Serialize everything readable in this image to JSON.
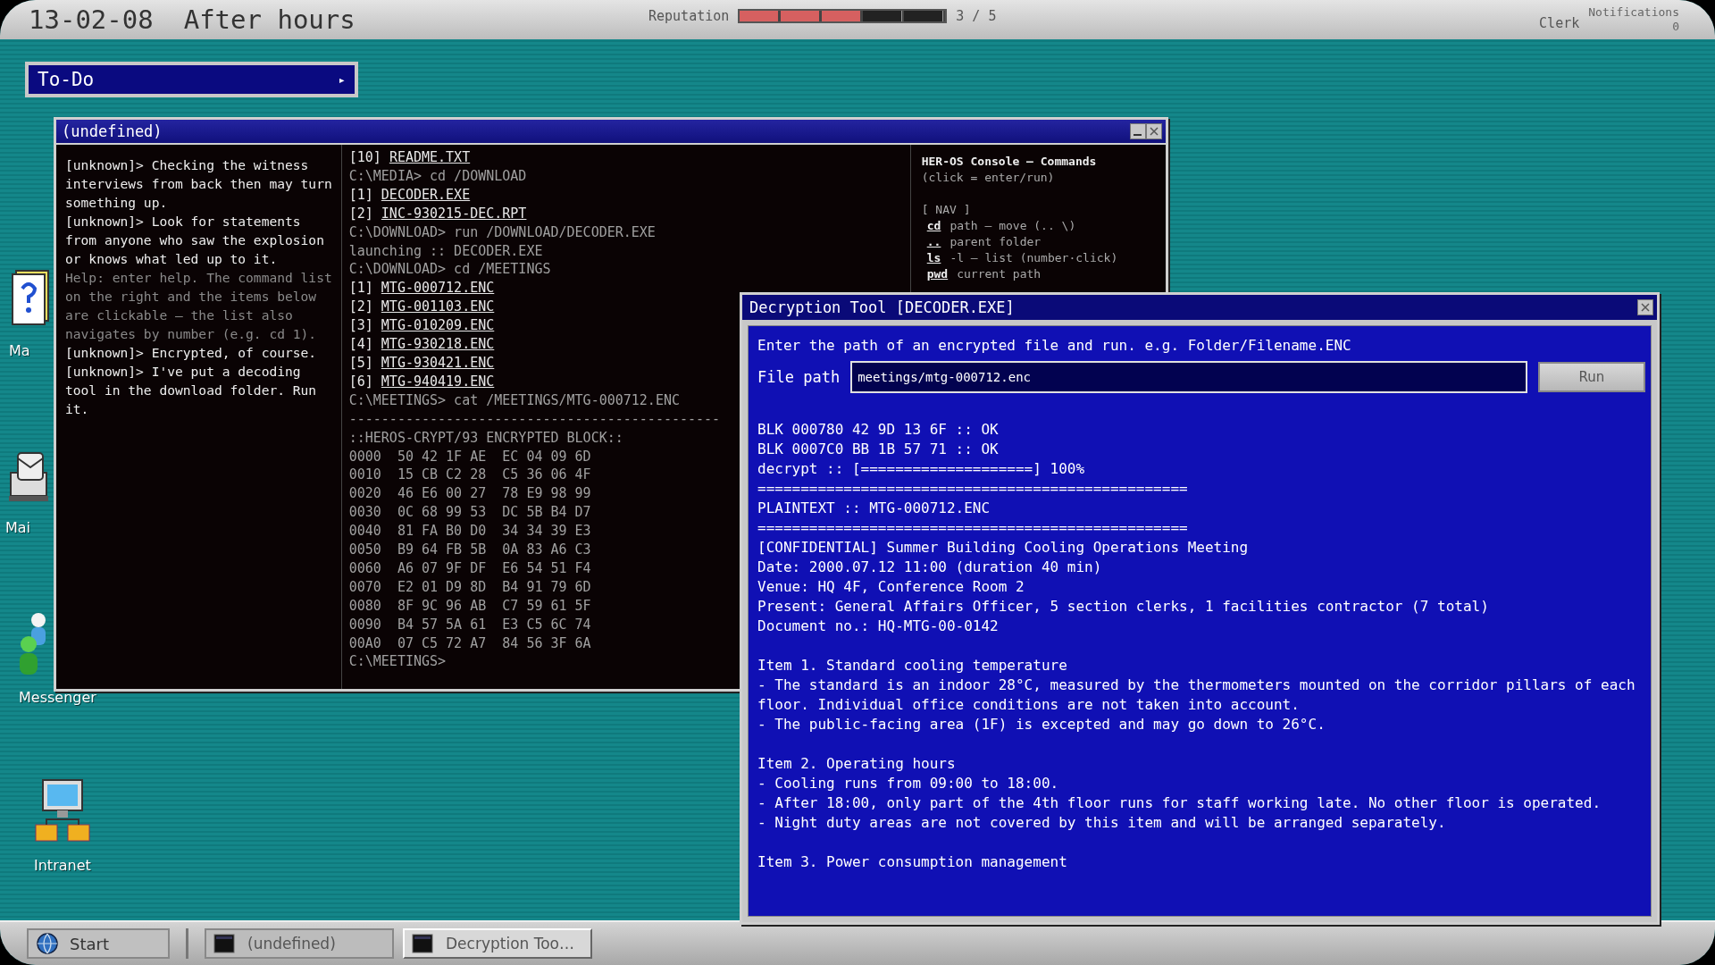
{
  "top_bar": {
    "date": "13-02-08",
    "phase": "After hours",
    "reputation": {
      "label": "Reputation",
      "level": 0.6,
      "reading": "3 / 5"
    },
    "role": "Clerk",
    "notifications": {
      "label": "Notifications",
      "count": "0"
    }
  },
  "todo": {
    "title": "To-Do",
    "arrow": "▸"
  },
  "desktop_icons": [
    {
      "kind": "help-book",
      "label": "Ma"
    },
    {
      "kind": "mail",
      "label": "Mai"
    },
    {
      "kind": "messenger",
      "label": "Messenger"
    },
    {
      "kind": "intranet",
      "label": "Intranet"
    }
  ],
  "console_window": {
    "title": "(undefined)",
    "messages": [
      {
        "kind": "chat",
        "text": "[unknown]> Checking the witness interviews from back then may turn something up."
      },
      {
        "kind": "chat",
        "text": "[unknown]> Look for statements from anyone who saw the explosion or knows what led up to it."
      },
      {
        "kind": "help",
        "text": "Help: enter help. The command list on the right and the items below are clickable — the list also navigates by number (e.g. cd 1)."
      },
      {
        "kind": "chat",
        "text": "[unknown]> Encrypted, of course."
      },
      {
        "kind": "chat",
        "text": "[unknown]> I've put a decoding tool in the download folder. Run it."
      }
    ],
    "listing": [
      {
        "kind": "item",
        "index": "[10]",
        "name": "README.TXT"
      },
      {
        "kind": "output",
        "text": "C:\\MEDIA> cd /DOWNLOAD"
      },
      {
        "kind": "item",
        "index": "[1]",
        "name": "DECODER.EXE"
      },
      {
        "kind": "item",
        "index": "[2]",
        "name": "INC-930215-DEC.RPT"
      },
      {
        "kind": "output",
        "text": "C:\\DOWNLOAD> run /DOWNLOAD/DECODER.EXE"
      },
      {
        "kind": "output",
        "text": "launching :: DECODER.EXE"
      },
      {
        "kind": "output",
        "text": "C:\\DOWNLOAD> cd /MEETINGS"
      },
      {
        "kind": "item",
        "index": "[1]",
        "name": "MTG-000712.ENC"
      },
      {
        "kind": "item",
        "index": "[2]",
        "name": "MTG-001103.ENC"
      },
      {
        "kind": "item",
        "index": "[3]",
        "name": "MTG-010209.ENC"
      },
      {
        "kind": "item",
        "index": "[4]",
        "name": "MTG-930218.ENC"
      },
      {
        "kind": "item",
        "index": "[5]",
        "name": "MTG-930421.ENC"
      },
      {
        "kind": "item",
        "index": "[6]",
        "name": "MTG-940419.ENC"
      },
      {
        "kind": "output",
        "text": "C:\\MEETINGS> cat /MEETINGS/MTG-000712.ENC"
      },
      {
        "kind": "output",
        "text": "----------------------------------------------"
      },
      {
        "kind": "output",
        "text": "::HEROS-CRYPT/93 ENCRYPTED BLOCK::"
      },
      {
        "kind": "output",
        "text": "0000  50 42 1F AE  EC 04 09 6D"
      },
      {
        "kind": "output",
        "text": "0010  15 CB C2 28  C5 36 06 4F"
      },
      {
        "kind": "output",
        "text": "0020  46 E6 00 27  78 E9 98 99"
      },
      {
        "kind": "output",
        "text": "0030  0C 68 99 53  DC 5B B4 D7"
      },
      {
        "kind": "output",
        "text": "0040  81 FA B0 D0  34 34 39 E3"
      },
      {
        "kind": "output",
        "text": "0050  B9 64 FB 5B  0A 83 A6 C3"
      },
      {
        "kind": "output",
        "text": "0060  A6 07 9F DF  E6 54 51 F4"
      },
      {
        "kind": "output",
        "text": "0070  E2 01 D9 8D  B4 91 79 6D"
      },
      {
        "kind": "output",
        "text": "0080  8F 9C 96 AB  C7 59 61 5F"
      },
      {
        "kind": "output",
        "text": "0090  B4 57 5A 61  E3 C5 6C 74"
      },
      {
        "kind": "output",
        "text": "00A0  07 C5 72 A7  84 56 3F 6A"
      },
      {
        "kind": "output",
        "text": "C:\\MEETINGS>"
      }
    ],
    "commands": {
      "title": "HER-OS Console — Commands",
      "hint": "(click = enter/run)",
      "section": "[ NAV ]",
      "items": [
        {
          "cmd": "cd",
          "desc": "path — move (.. \\)"
        },
        {
          "cmd": "..",
          "desc": "parent folder"
        },
        {
          "cmd": "ls",
          "desc": "-l — list (number·click)"
        },
        {
          "cmd": "pwd",
          "desc": "current path"
        }
      ]
    }
  },
  "decoder_window": {
    "title": "Decryption Tool [DECODER.EXE]",
    "instructions": "Enter the path of an encrypted file and run. e.g. Folder/Filename.ENC",
    "field_label": "File path",
    "value": "meetings/mtg-000712.enc",
    "run_button": "Run",
    "output": [
      [
        "BLK 000780  42 9D 13 6F :: OK",
        "BLK 0007C0  BB 1B 57 71 :: OK",
        "decrypt :: [====================] 100%",
        "==================================================",
        "PLAINTEXT :: MTG-000712.ENC",
        "==================================================",
        "[CONFIDENTIAL] Summer Building Cooling Operations Meeting",
        "Date: 2000.07.12 11:00 (duration 40 min)",
        "Venue: HQ 4F, Conference Room 2",
        "Present: General Affairs Officer, 5 section clerks, 1 facilities contractor (7 total)",
        "Document no.: HQ-MTG-00-0142"
      ],
      [
        "Item 1. Standard cooling temperature",
        "- The standard is an indoor 28°C, measured by the thermometers mounted on the corridor pillars of each floor. Individual office conditions are not taken into account.",
        "- The public-facing area (1F) is excepted and may go down to 26°C."
      ],
      [
        "Item 2. Operating hours",
        "- Cooling runs from 09:00 to 18:00.",
        "- After 18:00, only part of the 4th floor runs for staff working late. No other floor is operated.",
        "- Night duty areas are not covered by this item and will be arranged separately."
      ],
      [
        "Item 3. Power consumption management"
      ]
    ]
  },
  "taskbar": {
    "start": "Start",
    "tasks": [
      {
        "label": "(undefined)",
        "selected": false
      },
      {
        "label": "Decryption Too…",
        "selected": true
      }
    ]
  }
}
